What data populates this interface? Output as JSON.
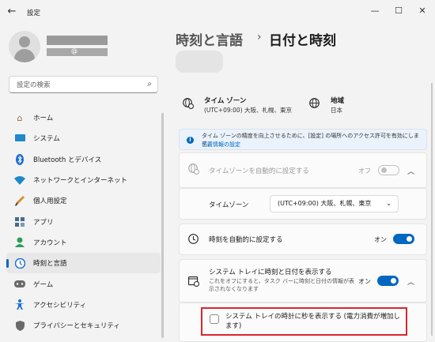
{
  "window": {
    "title": "設定"
  },
  "sidebar": {
    "account_email_suffix": "@",
    "search_placeholder": "設定の検索",
    "items": [
      {
        "label": "ホーム",
        "icon": "home-icon",
        "color": "#8a6d55"
      },
      {
        "label": "システム",
        "icon": "system-icon",
        "color": "#1e88c8"
      },
      {
        "label": "Bluetooth とデバイス",
        "icon": "bluetooth-icon",
        "color": "#1e6fd0"
      },
      {
        "label": "ネットワークとインターネット",
        "icon": "network-icon",
        "color": "#1e88c8"
      },
      {
        "label": "個人用設定",
        "icon": "brush-icon",
        "color": "#d98b2b"
      },
      {
        "label": "アプリ",
        "icon": "apps-icon",
        "color": "#4a6a8a"
      },
      {
        "label": "アカウント",
        "icon": "account-icon",
        "color": "#2e9e5b"
      },
      {
        "label": "時刻と言語",
        "icon": "time-language-icon",
        "color": "#1e6fd0",
        "active": true
      },
      {
        "label": "ゲーム",
        "icon": "game-icon",
        "color": "#5a5a5a"
      },
      {
        "label": "アクセシビリティ",
        "icon": "accessibility-icon",
        "color": "#1e6fd0"
      },
      {
        "label": "プライバシーとセキュリティ",
        "icon": "shield-icon",
        "color": "#6a6a6a"
      }
    ]
  },
  "header": {
    "parent": "時刻と言語",
    "separator": "›",
    "current": "日付と時刻"
  },
  "info": {
    "timezone_title": "タイム ゾーン",
    "timezone_value": "(UTC+09:00) 大阪、札幌、東京",
    "region_title": "地域",
    "region_value": "日本"
  },
  "banner": {
    "text": "タイム ゾーンの精度を向上させるために、[設定] の場所へのアクセス許可を有効にします。",
    "link": "位置情報の設定"
  },
  "settings": {
    "auto_timezone_label": "タイムゾーンを自動的に設定する",
    "auto_timezone_state": "オフ",
    "timezone_label": "タイムゾーン",
    "timezone_selected": "(UTC+09:00) 大阪、札幌、東京",
    "auto_time_label": "時刻を自動的に設定する",
    "auto_time_state": "オン",
    "tray_label": "システム トレイに時刻と日付を表示する",
    "tray_sub": "これをオフにすると、タスク バーに時刻と日付の情報が表示されなくなります",
    "tray_state": "オン",
    "seconds_label": "システム トレイの時計に秒を表示する (電力消費が増加します)"
  },
  "colors": {
    "accent": "#0067c0",
    "highlight": "#d9262f"
  }
}
